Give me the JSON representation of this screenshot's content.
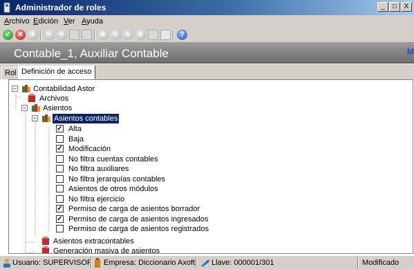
{
  "window": {
    "title": "Administrador de roles",
    "controls": [
      "_",
      "□",
      "X"
    ]
  },
  "menu": {
    "items": [
      "Archivo",
      "Edición",
      "Ver",
      "Ayuda"
    ]
  },
  "toolbar": {
    "icons": [
      "accept-icon",
      "cancel-icon",
      "add-icon",
      "remove-icon",
      "minus-icon",
      "copy-icon",
      "document-icon",
      "first-icon",
      "previous-icon",
      "next-icon",
      "last-icon",
      "box-icon",
      "sort-icon",
      "help-icon"
    ]
  },
  "header": {
    "title": "Contable_1, Auxiliar Contable",
    "corner_glyph": "M"
  },
  "tabs": [
    {
      "label": "Rol",
      "active": false
    },
    {
      "label": "Definición de acceso",
      "active": true
    }
  ],
  "tree": {
    "root": "Contabilidad Astor",
    "archivos": "Archivos",
    "asientos": "Asientos",
    "asientos_contables": "Asientos contables",
    "permissions": [
      {
        "label": "Alta",
        "checked": true
      },
      {
        "label": "Baja",
        "checked": false
      },
      {
        "label": "Modificación",
        "checked": true
      },
      {
        "label": "No filtra cuentas contables",
        "checked": false
      },
      {
        "label": "No filtra auxiliares",
        "checked": false
      },
      {
        "label": "No filtra jerarquías contables",
        "checked": false
      },
      {
        "label": "Asientos de otros módulos",
        "checked": false
      },
      {
        "label": "No filtra ejercicio",
        "checked": false
      },
      {
        "label": "Permiso de carga de asientos borrador",
        "checked": true
      },
      {
        "label": "Permiso de carga de asientos ingresados",
        "checked": true
      },
      {
        "label": "Permiso de carga de asientos registrados",
        "checked": false
      }
    ],
    "extracontables": "Asientos extracontables",
    "generacion": "Generación masiva de asientos"
  },
  "status": {
    "usuario": "Usuario: SUPERVISOR",
    "empresa": "Empresa: Diccionario Axoft",
    "llave": "Llave: 000001/301",
    "estado": "Modificado"
  },
  "colors": {
    "title_bar": "#0a246a",
    "selection": "#0a246a",
    "header": "#7f7f7f",
    "face": "#d4d0c8"
  }
}
